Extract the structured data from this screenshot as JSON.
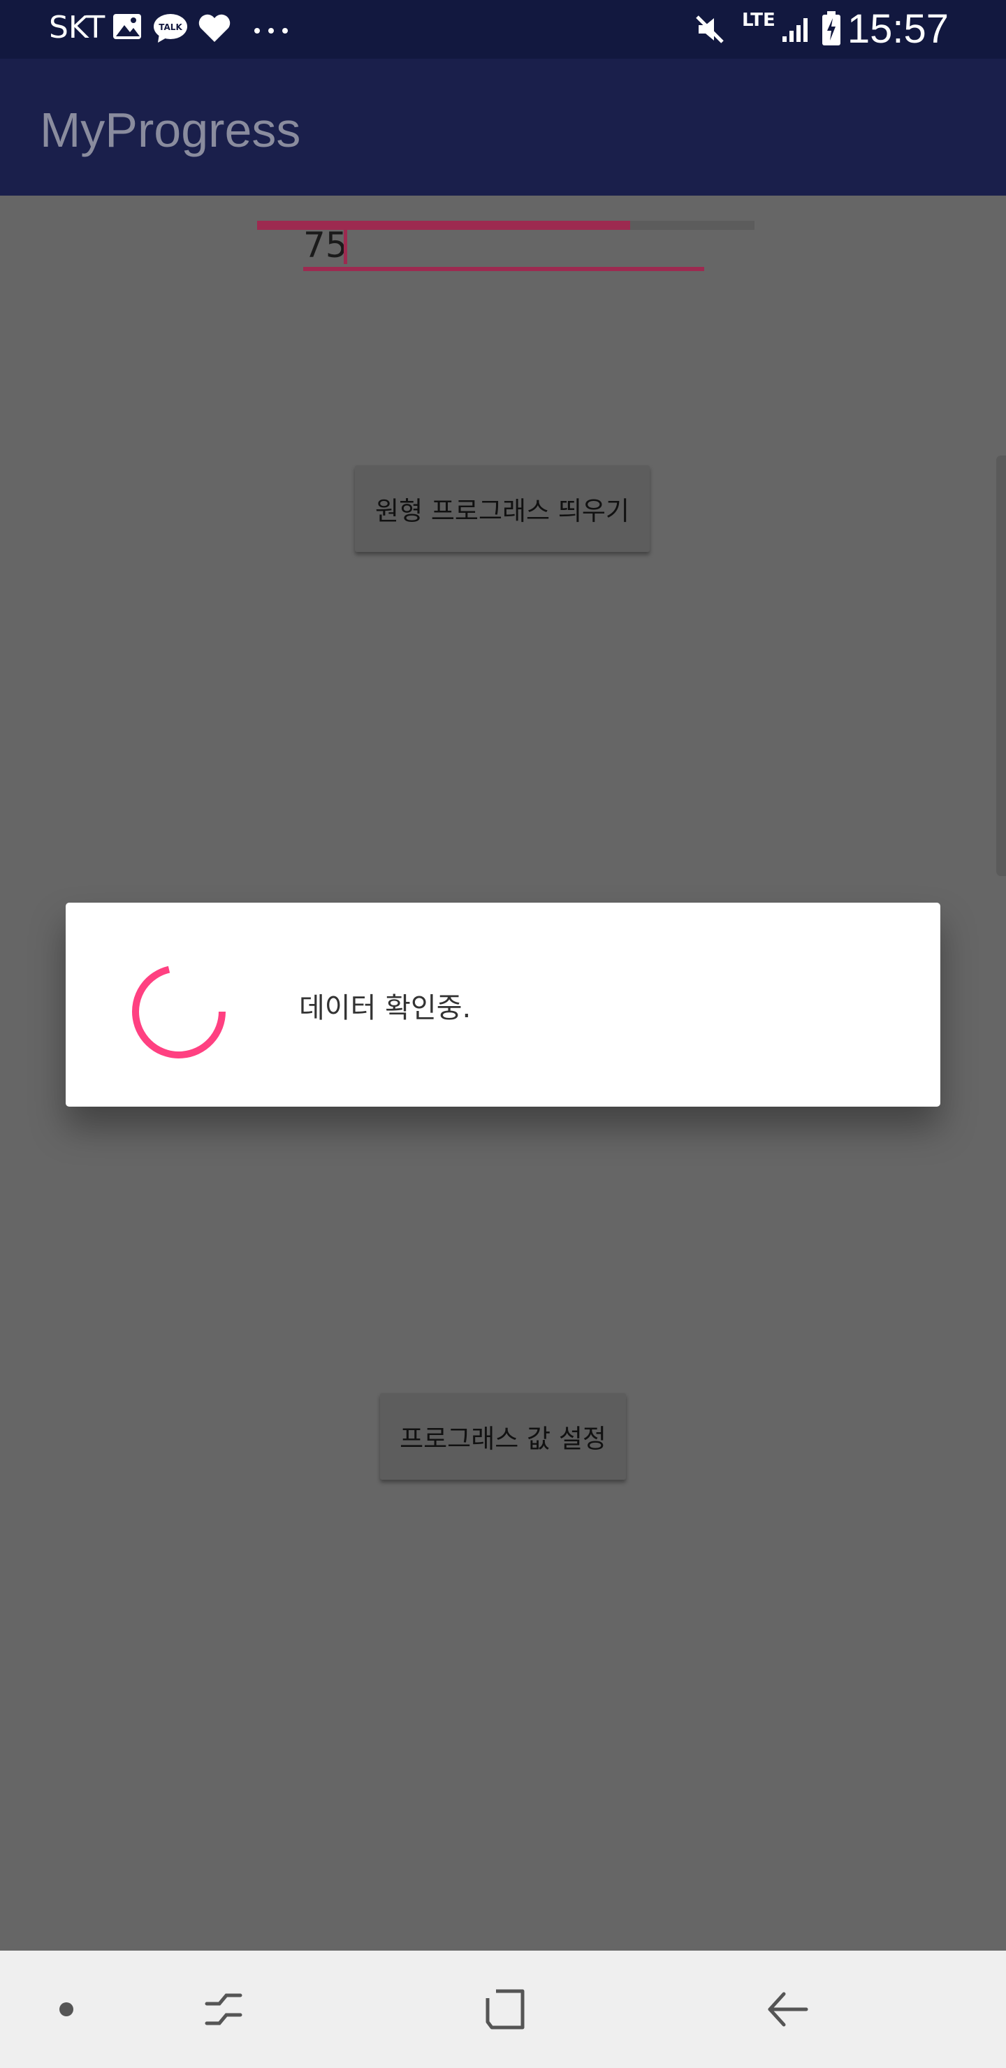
{
  "status_bar": {
    "carrier": "SKT",
    "network": "LTE",
    "time": "15:57",
    "icons": [
      "image-icon",
      "talk-icon",
      "heart-icon",
      "more-dots-icon",
      "mute-icon",
      "signal-icon",
      "battery-icon"
    ]
  },
  "app_bar": {
    "title": "MyProgress"
  },
  "main": {
    "progress_percent": 75,
    "input_value": "75",
    "show_circular_button_label": "원형 프로그래스 띄우기",
    "set_value_button_label": "프로그래스 값 설정"
  },
  "dialog": {
    "message": "데이터 확인중."
  },
  "colors": {
    "accent": "#ff4081",
    "primary": "#1a1f4b",
    "primary_dark": "#12183f"
  },
  "nav_bar": {
    "buttons": [
      "dot-icon",
      "recents-icon",
      "home-icon",
      "back-icon"
    ]
  }
}
